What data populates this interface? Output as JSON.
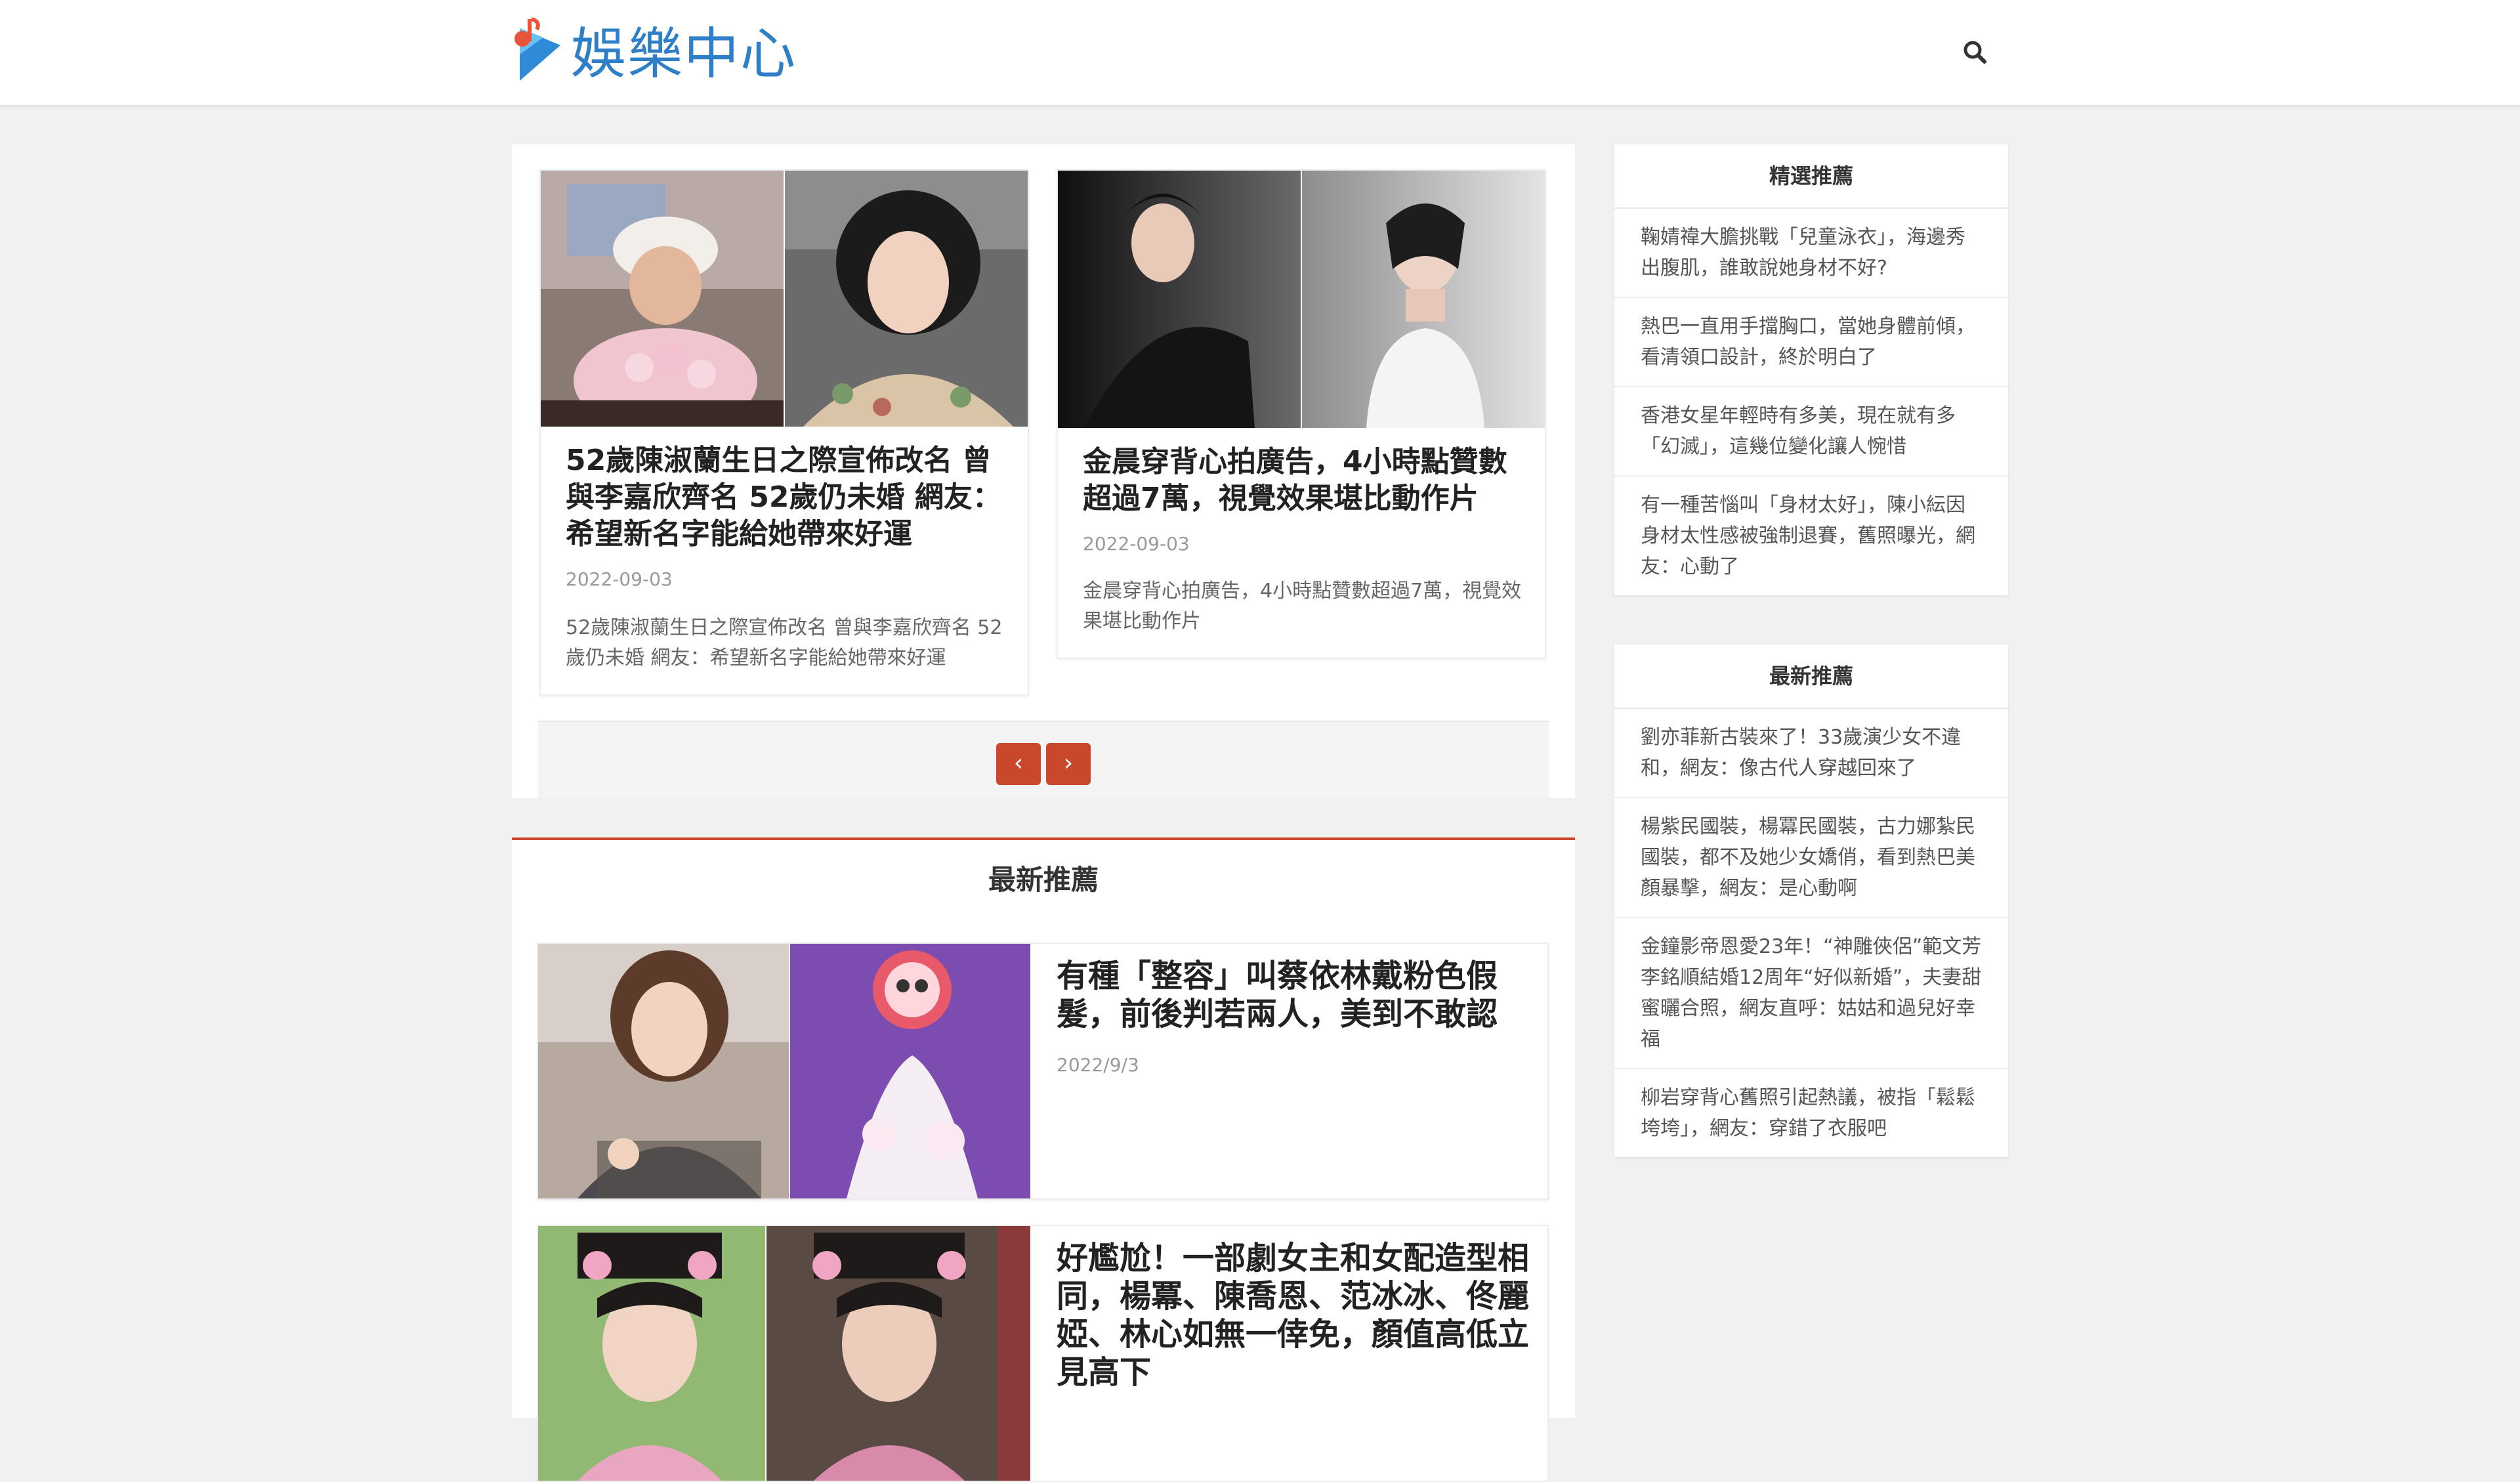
{
  "header": {
    "logo_text": "娛樂中心",
    "search_icon": "search-icon"
  },
  "slider": {
    "cards": [
      {
        "title": "52歲陳淑蘭生日之際宣佈改名 曾與李嘉欣齊名 52歲仍未婚 網友：希望新名字能給她帶來好運",
        "date": "2022-09-03",
        "excerpt": "52歲陳淑蘭生日之際宣佈改名 曾與李嘉欣齊名 52歲仍未婚 網友：希望新名字能給她帶來好運"
      },
      {
        "title": "金晨穿背心拍廣告，4小時點贊數超過7萬，視覺效果堪比動作片",
        "date": "2022-09-03",
        "excerpt": "金晨穿背心拍廣告，4小時點贊數超過7萬，視覺效果堪比動作片"
      }
    ],
    "prev_label": "‹",
    "next_label": "›"
  },
  "latest_section": {
    "heading": "最新推薦",
    "items": [
      {
        "title": "有種「整容」叫蔡依林戴粉色假髮，前後判若兩人，美到不敢認",
        "date": "2022/9/3"
      },
      {
        "title": "好尷尬！一部劇女主和女配造型相同，楊冪、陳喬恩、范冰冰、佟麗婭、林心如無一倖免，顏值高低立見高下",
        "date": ""
      }
    ]
  },
  "sidebar": {
    "featured": {
      "title": "精選推薦",
      "items": [
        "鞠婧禕大膽挑戰「兒童泳衣」，海邊秀出腹肌，誰敢說她身材不好?",
        "熱巴一直用手擋胸口，當她身體前傾，看清領口設計，終於明白了",
        "香港女星年輕時有多美，現在就有多「幻滅」，這幾位變化讓人惋惜",
        "有一種苦惱叫「身材太好」，陳小紜因身材太性感被強制退賽，舊照曝光，網友：心動了"
      ]
    },
    "latest": {
      "title": "最新推薦",
      "items": [
        "劉亦菲新古裝來了！33歲演少女不違和，網友：像古代人穿越回來了",
        "楊紫民國裝，楊冪民國裝，古力娜紮民國裝，都不及她少女嬌俏，看到熱巴美顏暴擊，網友：是心動啊",
        "金鐘影帝恩愛23年！“神雕俠侶”範文芳李銘順結婚12周年“好似新婚”，夫妻甜蜜曬合照，網友直呼：姑姑和過兒好幸福",
        "柳岩穿背心舊照引起熱議，被指「鬆鬆垮垮」，網友：穿錯了衣服吧"
      ]
    }
  }
}
